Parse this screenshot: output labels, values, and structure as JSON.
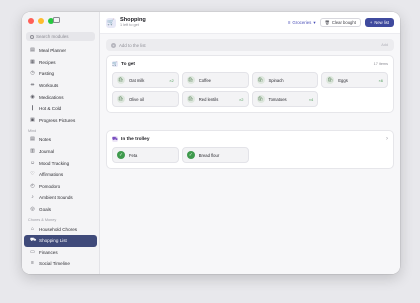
{
  "sidebar": {
    "search_placeholder": "Search modules",
    "items_top": [
      {
        "label": "Meal Planner",
        "icon": "meal-icon"
      },
      {
        "label": "Recipes",
        "icon": "recipe-icon"
      },
      {
        "label": "Fasting",
        "icon": "timer-icon"
      },
      {
        "label": "Workouts",
        "icon": "dumbbell-icon"
      },
      {
        "label": "Medications",
        "icon": "pill-icon"
      },
      {
        "label": "Hot & Cold",
        "icon": "thermometer-icon"
      },
      {
        "label": "Progress Pictures",
        "icon": "image-icon"
      }
    ],
    "section_mind": "Mind",
    "items_mind": [
      {
        "label": "Notes",
        "icon": "note-icon"
      },
      {
        "label": "Journal",
        "icon": "journal-icon"
      },
      {
        "label": "Mood Tracking",
        "icon": "smile-icon"
      },
      {
        "label": "Affirmations",
        "icon": "heart-icon"
      },
      {
        "label": "Pomodoro",
        "icon": "clock-icon"
      },
      {
        "label": "Ambient Sounds",
        "icon": "sound-icon"
      },
      {
        "label": "Goals",
        "icon": "target-icon"
      }
    ],
    "section_chores": "Chores & Money",
    "items_chores": [
      {
        "label": "Household Chores",
        "icon": "home-icon"
      },
      {
        "label": "Shopping List",
        "icon": "cart-icon"
      },
      {
        "label": "Finances",
        "icon": "wallet-icon"
      },
      {
        "label": "Social Timeline",
        "icon": "timeline-icon"
      }
    ]
  },
  "header": {
    "title": "Shopping",
    "subtitle": "1 left to get",
    "list_select": "Groceries",
    "clear_label": "Clear bought",
    "new_label": "New list"
  },
  "add_row": {
    "placeholder": "Add to the list",
    "button": "Add"
  },
  "to_get": {
    "title": "To get",
    "count": "17 items",
    "items": [
      {
        "name": "Oat milk",
        "qty": "×2"
      },
      {
        "name": "Coffee",
        "qty": ""
      },
      {
        "name": "Spinach",
        "qty": ""
      },
      {
        "name": "Eggs",
        "qty": "×6"
      },
      {
        "name": "Olive oil",
        "qty": ""
      },
      {
        "name": "Red lentils",
        "qty": "×2"
      },
      {
        "name": "Tomatoes",
        "qty": "×4"
      }
    ]
  },
  "trolley": {
    "title": "In the trolley",
    "items": [
      {
        "name": "Feta"
      },
      {
        "name": "Bread flour"
      }
    ]
  },
  "colors": {
    "accent": "#3f4a9e",
    "active_nav": "#3f4a7a",
    "green": "#3f9a4d"
  }
}
